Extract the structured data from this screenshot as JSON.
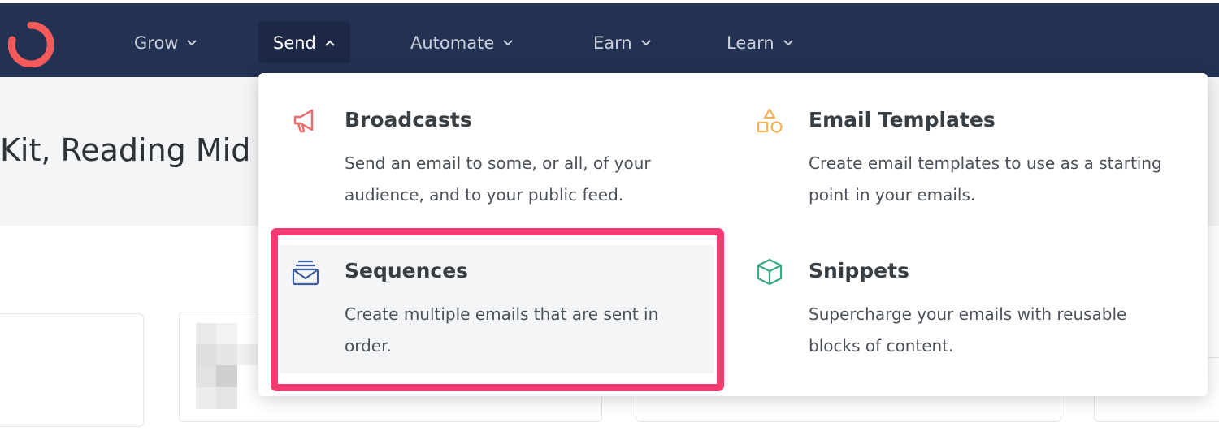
{
  "nav": {
    "items": [
      {
        "label": "Grow",
        "state": "collapsed"
      },
      {
        "label": "Send",
        "state": "expanded"
      },
      {
        "label": "Automate",
        "state": "collapsed"
      },
      {
        "label": "Earn",
        "state": "collapsed"
      },
      {
        "label": "Learn",
        "state": "collapsed"
      }
    ]
  },
  "page": {
    "title_fragment": "Kit, Reading Mid"
  },
  "dropdown": {
    "entries": [
      {
        "title": "Broadcasts",
        "description": "Send an email to some, or all, of your audience, and to your public feed.",
        "icon": "megaphone-icon"
      },
      {
        "title": "Email Templates",
        "description": "Create email templates to use as a starting point in your emails.",
        "icon": "shapes-icon"
      },
      {
        "title": "Sequences",
        "description": "Create multiple emails that are sent in order.",
        "icon": "stacked-mail-icon"
      },
      {
        "title": "Snippets",
        "description": "Supercharge your emails with reusable blocks of content.",
        "icon": "cube-icon"
      }
    ]
  },
  "colors": {
    "nav_bg": "#233153",
    "logo": "#f55a5a",
    "highlight": "#f53b72",
    "broadcast_icon": "#f06a6a",
    "templates_icon": "#f1b15a",
    "sequences_icon": "#3f5c9c",
    "snippets_icon": "#3aaa80"
  }
}
